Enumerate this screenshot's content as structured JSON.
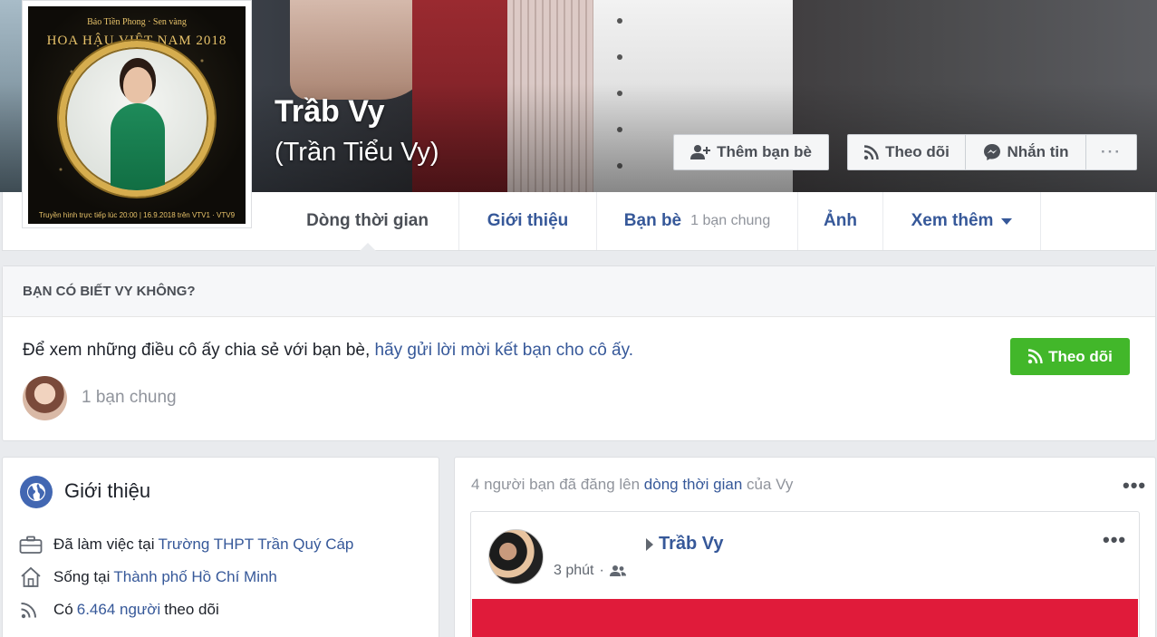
{
  "profile": {
    "name": "Trầb Vy",
    "alt_name": "(Trần Tiểu Vy)"
  },
  "avatar_art": {
    "title": "Báo Tiền Phong · Sen vàng",
    "arc": "HOA HẬU VIỆT NAM 2018",
    "caption": "Truyền hình trực tiếp lúc 20:00 | 16.9.2018 trên VTV1 · VTV9"
  },
  "cover_actions": {
    "add_friend": "Thêm bạn bè",
    "follow": "Theo dõi",
    "message": "Nhắn tin",
    "more": "···"
  },
  "tabs": [
    {
      "label": "Dòng thời gian",
      "active": true
    },
    {
      "label": "Giới thiệu"
    },
    {
      "label": "Bạn bè",
      "sub": "1 bạn chung"
    },
    {
      "label": "Ảnh"
    },
    {
      "label": "Xem thêm"
    }
  ],
  "know_card": {
    "heading": "BẠN CÓ BIẾT VY KHÔNG?",
    "text": "Để xem những điều cô ấy chia sẻ với bạn bè, ",
    "link": "hãy gửi lời mời kết bạn cho cô ấy.",
    "follow_button": "Theo dõi",
    "mutual": "1 bạn chung"
  },
  "intro": {
    "title": "Giới thiệu",
    "work_prefix": "Đã làm việc tại",
    "work_link": "Trường THPT Trần Quý Cáp",
    "live_prefix": "Sống tại",
    "live_link": "Thành phố Hồ Chí Minh",
    "followers_prefix": "Có",
    "followers_link": "6.464 người",
    "followers_suffix": "theo dõi"
  },
  "posts": {
    "header_prefix": "4 người bạn đã đăng lên ",
    "header_link": "dòng thời gian",
    "header_suffix": " của Vy",
    "post": {
      "author": "Trầb Vy",
      "time": "3 phút",
      "separator": "·"
    }
  },
  "colors": {
    "link": "#365899",
    "follow_green": "#42b72a",
    "banner_red": "#e01b3a",
    "page_bg": "#e9ebee"
  }
}
